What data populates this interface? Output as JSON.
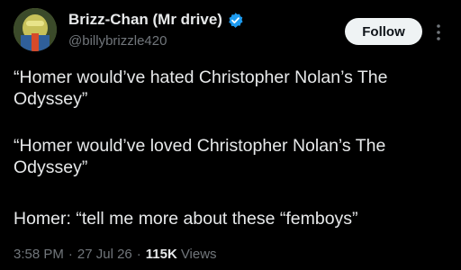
{
  "author": {
    "display_name": "Brizz-Chan (Mr drive)",
    "handle": "@billybrizzle420",
    "verified_icon": "verified-badge-icon",
    "avatar": "avatar-image"
  },
  "actions": {
    "follow_label": "Follow",
    "more_icon": "more-vertical-icon"
  },
  "tweet": {
    "paragraphs": [
      "“Homer would’ve hated Christopher Nolan’s The Odyssey”",
      "“Homer would’ve loved Christopher Nolan’s The Odyssey”",
      "Homer: “tell me more about these “femboys”"
    ]
  },
  "meta": {
    "time": "3:58 PM",
    "date": "27 Jul 26",
    "views_count": "115K",
    "views_label": "Views",
    "separator": "·"
  },
  "colors": {
    "background": "#000000",
    "primary_text": "#e7e9ea",
    "secondary_text": "#71767b",
    "verified_blue": "#1d9bf0",
    "follow_button_bg": "#eff3f4"
  }
}
